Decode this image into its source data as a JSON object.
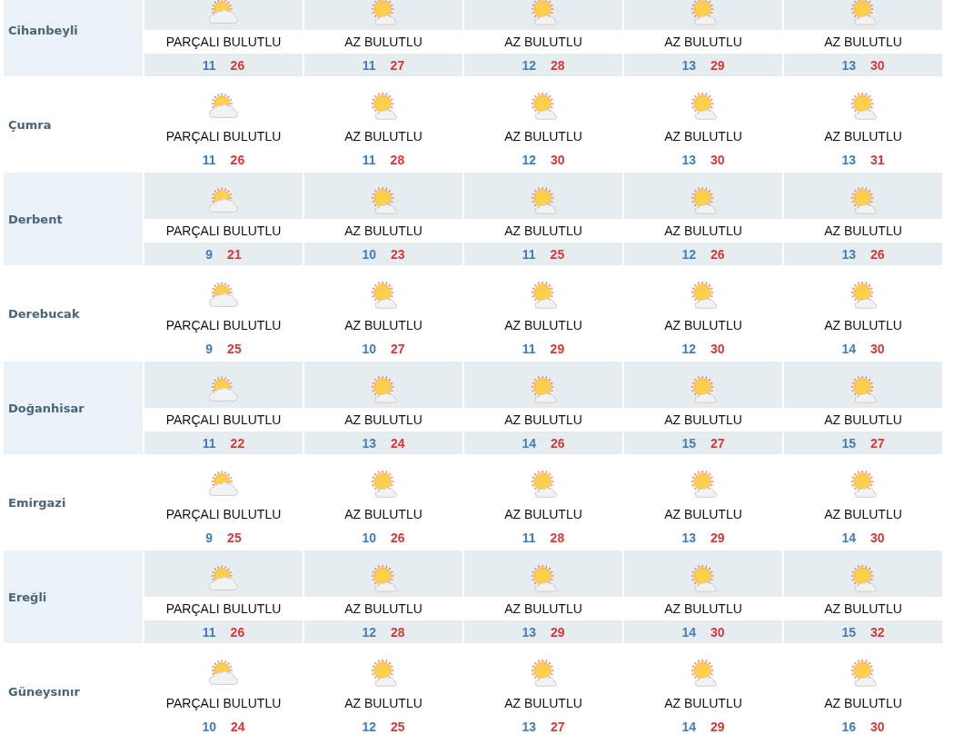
{
  "towns": [
    {
      "name": "Cihanbeyli",
      "days": [
        {
          "kind": "partly_cloudy",
          "condition": "PARÇALI BULUTLU",
          "low": "11",
          "high": "26"
        },
        {
          "kind": "mostly_sunny",
          "condition": "AZ BULUTLU",
          "low": "11",
          "high": "27"
        },
        {
          "kind": "mostly_sunny",
          "condition": "AZ BULUTLU",
          "low": "12",
          "high": "28"
        },
        {
          "kind": "mostly_sunny",
          "condition": "AZ BULUTLU",
          "low": "13",
          "high": "29"
        },
        {
          "kind": "mostly_sunny",
          "condition": "AZ BULUTLU",
          "low": "13",
          "high": "30"
        }
      ]
    },
    {
      "name": "Çumra",
      "days": [
        {
          "kind": "partly_cloudy",
          "condition": "PARÇALI BULUTLU",
          "low": "11",
          "high": "26"
        },
        {
          "kind": "mostly_sunny",
          "condition": "AZ BULUTLU",
          "low": "11",
          "high": "28"
        },
        {
          "kind": "mostly_sunny",
          "condition": "AZ BULUTLU",
          "low": "12",
          "high": "30"
        },
        {
          "kind": "mostly_sunny",
          "condition": "AZ BULUTLU",
          "low": "13",
          "high": "30"
        },
        {
          "kind": "mostly_sunny",
          "condition": "AZ BULUTLU",
          "low": "13",
          "high": "31"
        }
      ]
    },
    {
      "name": "Derbent",
      "days": [
        {
          "kind": "partly_cloudy",
          "condition": "PARÇALI BULUTLU",
          "low": "9",
          "high": "21"
        },
        {
          "kind": "mostly_sunny",
          "condition": "AZ BULUTLU",
          "low": "10",
          "high": "23"
        },
        {
          "kind": "mostly_sunny",
          "condition": "AZ BULUTLU",
          "low": "11",
          "high": "25"
        },
        {
          "kind": "mostly_sunny",
          "condition": "AZ BULUTLU",
          "low": "12",
          "high": "26"
        },
        {
          "kind": "mostly_sunny",
          "condition": "AZ BULUTLU",
          "low": "13",
          "high": "26"
        }
      ]
    },
    {
      "name": "Derebucak",
      "days": [
        {
          "kind": "partly_cloudy",
          "condition": "PARÇALI BULUTLU",
          "low": "9",
          "high": "25"
        },
        {
          "kind": "mostly_sunny",
          "condition": "AZ BULUTLU",
          "low": "10",
          "high": "27"
        },
        {
          "kind": "mostly_sunny",
          "condition": "AZ BULUTLU",
          "low": "11",
          "high": "29"
        },
        {
          "kind": "mostly_sunny",
          "condition": "AZ BULUTLU",
          "low": "12",
          "high": "30"
        },
        {
          "kind": "mostly_sunny",
          "condition": "AZ BULUTLU",
          "low": "14",
          "high": "30"
        }
      ]
    },
    {
      "name": "Doğanhisar",
      "days": [
        {
          "kind": "partly_cloudy",
          "condition": "PARÇALI BULUTLU",
          "low": "11",
          "high": "22"
        },
        {
          "kind": "mostly_sunny",
          "condition": "AZ BULUTLU",
          "low": "13",
          "high": "24"
        },
        {
          "kind": "mostly_sunny",
          "condition": "AZ BULUTLU",
          "low": "14",
          "high": "26"
        },
        {
          "kind": "mostly_sunny",
          "condition": "AZ BULUTLU",
          "low": "15",
          "high": "27"
        },
        {
          "kind": "mostly_sunny",
          "condition": "AZ BULUTLU",
          "low": "15",
          "high": "27"
        }
      ]
    },
    {
      "name": "Emirgazi",
      "days": [
        {
          "kind": "partly_cloudy",
          "condition": "PARÇALI BULUTLU",
          "low": "9",
          "high": "25"
        },
        {
          "kind": "mostly_sunny",
          "condition": "AZ BULUTLU",
          "low": "10",
          "high": "26"
        },
        {
          "kind": "mostly_sunny",
          "condition": "AZ BULUTLU",
          "low": "11",
          "high": "28"
        },
        {
          "kind": "mostly_sunny",
          "condition": "AZ BULUTLU",
          "low": "13",
          "high": "29"
        },
        {
          "kind": "mostly_sunny",
          "condition": "AZ BULUTLU",
          "low": "14",
          "high": "30"
        }
      ]
    },
    {
      "name": "Ereğli",
      "days": [
        {
          "kind": "partly_cloudy",
          "condition": "PARÇALI BULUTLU",
          "low": "11",
          "high": "26"
        },
        {
          "kind": "mostly_sunny",
          "condition": "AZ BULUTLU",
          "low": "12",
          "high": "28"
        },
        {
          "kind": "mostly_sunny",
          "condition": "AZ BULUTLU",
          "low": "13",
          "high": "29"
        },
        {
          "kind": "mostly_sunny",
          "condition": "AZ BULUTLU",
          "low": "14",
          "high": "30"
        },
        {
          "kind": "mostly_sunny",
          "condition": "AZ BULUTLU",
          "low": "15",
          "high": "32"
        }
      ]
    },
    {
      "name": "Güneysınır",
      "days": [
        {
          "kind": "partly_cloudy",
          "condition": "PARÇALI BULUTLU",
          "low": "10",
          "high": "24"
        },
        {
          "kind": "mostly_sunny",
          "condition": "AZ BULUTLU",
          "low": "12",
          "high": "25"
        },
        {
          "kind": "mostly_sunny",
          "condition": "AZ BULUTLU",
          "low": "13",
          "high": "27"
        },
        {
          "kind": "mostly_sunny",
          "condition": "AZ BULUTLU",
          "low": "14",
          "high": "29"
        },
        {
          "kind": "mostly_sunny",
          "condition": "AZ BULUTLU",
          "low": "16",
          "high": "30"
        }
      ]
    }
  ]
}
